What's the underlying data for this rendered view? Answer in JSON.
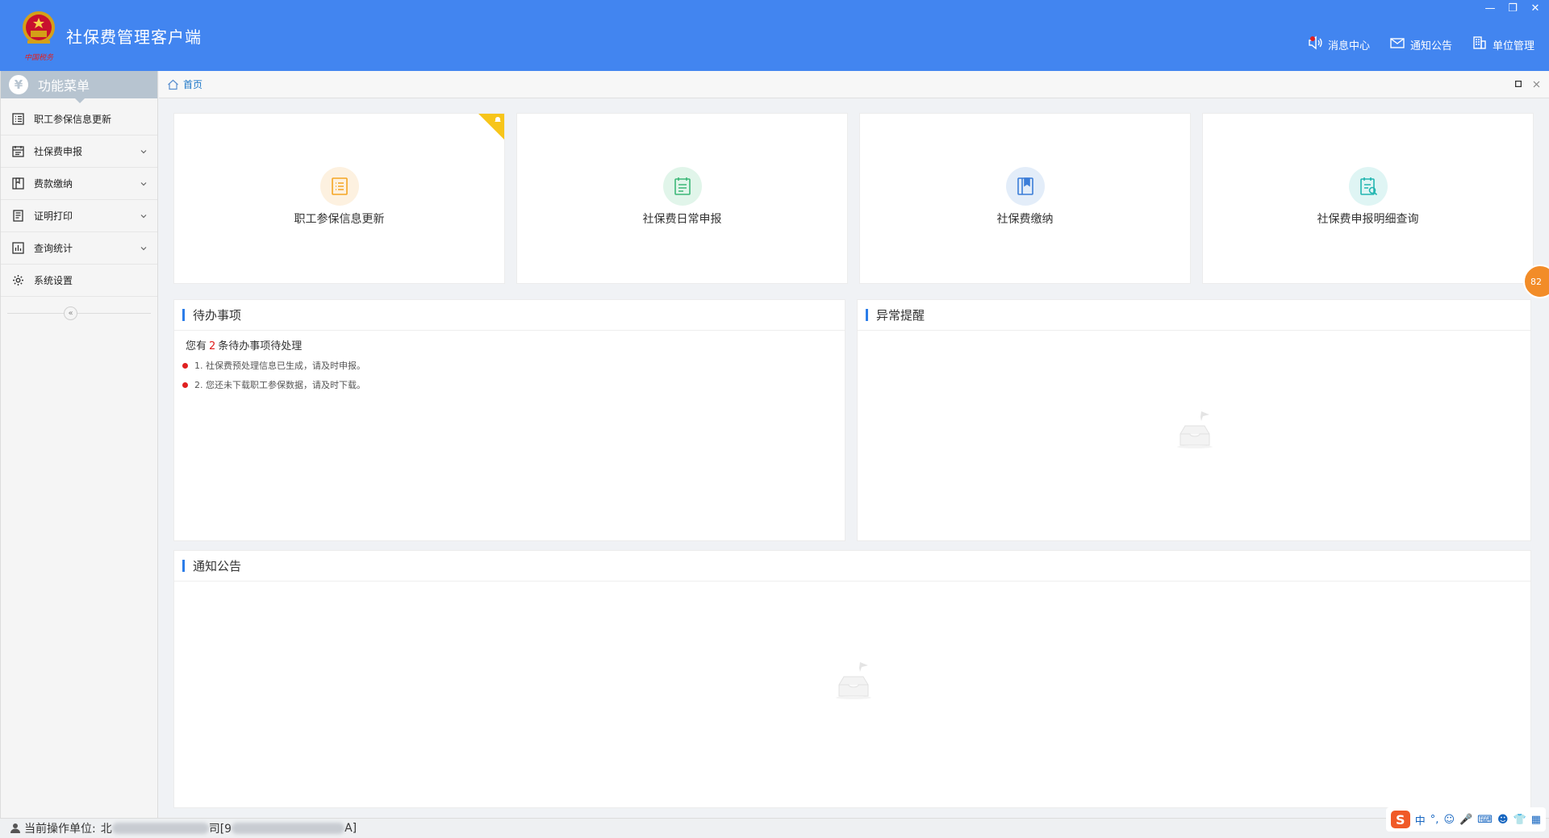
{
  "app": {
    "title": "社保费管理客户端",
    "logo_caption": "中国税务"
  },
  "window_controls": {
    "minimize": "—",
    "restore": "❐",
    "close": "✕"
  },
  "top_nav": [
    {
      "label": "消息中心",
      "icon": "speaker-icon"
    },
    {
      "label": "通知公告",
      "icon": "envelope-icon"
    },
    {
      "label": "单位管理",
      "icon": "building-icon"
    }
  ],
  "sidebar": {
    "header": "功能菜单",
    "header_icon": "¥",
    "items": [
      {
        "label": "职工参保信息更新",
        "has_sub": false,
        "icon": "list-icon"
      },
      {
        "label": "社保费申报",
        "has_sub": true,
        "icon": "calendar-icon"
      },
      {
        "label": "费款缴纳",
        "has_sub": true,
        "icon": "book-icon"
      },
      {
        "label": "证明打印",
        "has_sub": true,
        "icon": "document-icon"
      },
      {
        "label": "查询统计",
        "has_sub": true,
        "icon": "bar-chart-icon"
      },
      {
        "label": "系统设置",
        "has_sub": false,
        "icon": "gear-icon"
      }
    ],
    "collapse_label": "«"
  },
  "breadcrumb": {
    "home": "首页"
  },
  "cards": [
    {
      "label": "职工参保信息更新",
      "icon": "list-icon",
      "color": "#f5a623",
      "bg": "#fdf1e0",
      "badge": true
    },
    {
      "label": "社保费日常申报",
      "icon": "calendar-list-icon",
      "color": "#3cb878",
      "bg": "#e1f5ea",
      "badge": false
    },
    {
      "label": "社保费缴纳",
      "icon": "book-icon",
      "color": "#3b7dd8",
      "bg": "#e3edf9",
      "badge": false
    },
    {
      "label": "社保费申报明细查询",
      "icon": "search-document-icon",
      "color": "#22b5b0",
      "bg": "#dff5f4",
      "badge": false
    }
  ],
  "todo": {
    "title": "待办事项",
    "summary_prefix": "您有",
    "count": "2",
    "summary_suffix": "条待办事项待处理",
    "items": [
      "1. 社保费预处理信息已生成，请及时申报。",
      "2. 您还未下载职工参保数据，请及时下载。"
    ]
  },
  "alerts": {
    "title": "异常提醒"
  },
  "notices": {
    "title": "通知公告"
  },
  "status": {
    "label": "当前操作单位:",
    "unit_start": "北",
    "unit_mid": "司[9",
    "unit_end": "A]"
  },
  "ime": {
    "lang": "中",
    "punct": "°,"
  },
  "float_badge": "82"
}
